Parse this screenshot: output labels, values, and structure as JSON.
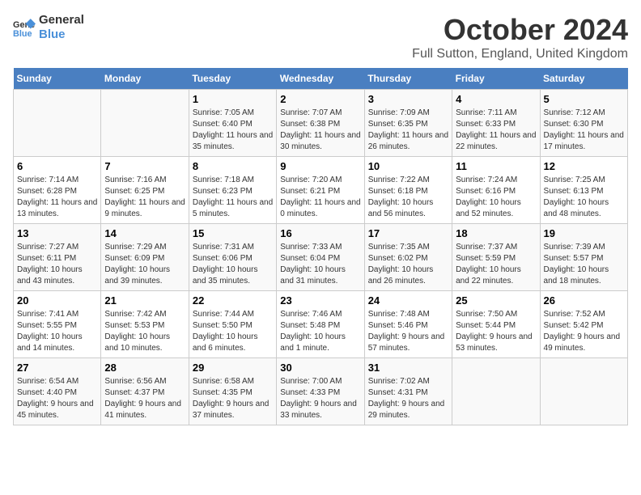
{
  "logo": {
    "line1": "General",
    "line2": "Blue"
  },
  "title": "October 2024",
  "subtitle": "Full Sutton, England, United Kingdom",
  "days_of_week": [
    "Sunday",
    "Monday",
    "Tuesday",
    "Wednesday",
    "Thursday",
    "Friday",
    "Saturday"
  ],
  "weeks": [
    [
      {
        "day": "",
        "sunrise": "",
        "sunset": "",
        "daylight": ""
      },
      {
        "day": "",
        "sunrise": "",
        "sunset": "",
        "daylight": ""
      },
      {
        "day": "1",
        "sunrise": "Sunrise: 7:05 AM",
        "sunset": "Sunset: 6:40 PM",
        "daylight": "Daylight: 11 hours and 35 minutes."
      },
      {
        "day": "2",
        "sunrise": "Sunrise: 7:07 AM",
        "sunset": "Sunset: 6:38 PM",
        "daylight": "Daylight: 11 hours and 30 minutes."
      },
      {
        "day": "3",
        "sunrise": "Sunrise: 7:09 AM",
        "sunset": "Sunset: 6:35 PM",
        "daylight": "Daylight: 11 hours and 26 minutes."
      },
      {
        "day": "4",
        "sunrise": "Sunrise: 7:11 AM",
        "sunset": "Sunset: 6:33 PM",
        "daylight": "Daylight: 11 hours and 22 minutes."
      },
      {
        "day": "5",
        "sunrise": "Sunrise: 7:12 AM",
        "sunset": "Sunset: 6:30 PM",
        "daylight": "Daylight: 11 hours and 17 minutes."
      }
    ],
    [
      {
        "day": "6",
        "sunrise": "Sunrise: 7:14 AM",
        "sunset": "Sunset: 6:28 PM",
        "daylight": "Daylight: 11 hours and 13 minutes."
      },
      {
        "day": "7",
        "sunrise": "Sunrise: 7:16 AM",
        "sunset": "Sunset: 6:25 PM",
        "daylight": "Daylight: 11 hours and 9 minutes."
      },
      {
        "day": "8",
        "sunrise": "Sunrise: 7:18 AM",
        "sunset": "Sunset: 6:23 PM",
        "daylight": "Daylight: 11 hours and 5 minutes."
      },
      {
        "day": "9",
        "sunrise": "Sunrise: 7:20 AM",
        "sunset": "Sunset: 6:21 PM",
        "daylight": "Daylight: 11 hours and 0 minutes."
      },
      {
        "day": "10",
        "sunrise": "Sunrise: 7:22 AM",
        "sunset": "Sunset: 6:18 PM",
        "daylight": "Daylight: 10 hours and 56 minutes."
      },
      {
        "day": "11",
        "sunrise": "Sunrise: 7:24 AM",
        "sunset": "Sunset: 6:16 PM",
        "daylight": "Daylight: 10 hours and 52 minutes."
      },
      {
        "day": "12",
        "sunrise": "Sunrise: 7:25 AM",
        "sunset": "Sunset: 6:13 PM",
        "daylight": "Daylight: 10 hours and 48 minutes."
      }
    ],
    [
      {
        "day": "13",
        "sunrise": "Sunrise: 7:27 AM",
        "sunset": "Sunset: 6:11 PM",
        "daylight": "Daylight: 10 hours and 43 minutes."
      },
      {
        "day": "14",
        "sunrise": "Sunrise: 7:29 AM",
        "sunset": "Sunset: 6:09 PM",
        "daylight": "Daylight: 10 hours and 39 minutes."
      },
      {
        "day": "15",
        "sunrise": "Sunrise: 7:31 AM",
        "sunset": "Sunset: 6:06 PM",
        "daylight": "Daylight: 10 hours and 35 minutes."
      },
      {
        "day": "16",
        "sunrise": "Sunrise: 7:33 AM",
        "sunset": "Sunset: 6:04 PM",
        "daylight": "Daylight: 10 hours and 31 minutes."
      },
      {
        "day": "17",
        "sunrise": "Sunrise: 7:35 AM",
        "sunset": "Sunset: 6:02 PM",
        "daylight": "Daylight: 10 hours and 26 minutes."
      },
      {
        "day": "18",
        "sunrise": "Sunrise: 7:37 AM",
        "sunset": "Sunset: 5:59 PM",
        "daylight": "Daylight: 10 hours and 22 minutes."
      },
      {
        "day": "19",
        "sunrise": "Sunrise: 7:39 AM",
        "sunset": "Sunset: 5:57 PM",
        "daylight": "Daylight: 10 hours and 18 minutes."
      }
    ],
    [
      {
        "day": "20",
        "sunrise": "Sunrise: 7:41 AM",
        "sunset": "Sunset: 5:55 PM",
        "daylight": "Daylight: 10 hours and 14 minutes."
      },
      {
        "day": "21",
        "sunrise": "Sunrise: 7:42 AM",
        "sunset": "Sunset: 5:53 PM",
        "daylight": "Daylight: 10 hours and 10 minutes."
      },
      {
        "day": "22",
        "sunrise": "Sunrise: 7:44 AM",
        "sunset": "Sunset: 5:50 PM",
        "daylight": "Daylight: 10 hours and 6 minutes."
      },
      {
        "day": "23",
        "sunrise": "Sunrise: 7:46 AM",
        "sunset": "Sunset: 5:48 PM",
        "daylight": "Daylight: 10 hours and 1 minute."
      },
      {
        "day": "24",
        "sunrise": "Sunrise: 7:48 AM",
        "sunset": "Sunset: 5:46 PM",
        "daylight": "Daylight: 9 hours and 57 minutes."
      },
      {
        "day": "25",
        "sunrise": "Sunrise: 7:50 AM",
        "sunset": "Sunset: 5:44 PM",
        "daylight": "Daylight: 9 hours and 53 minutes."
      },
      {
        "day": "26",
        "sunrise": "Sunrise: 7:52 AM",
        "sunset": "Sunset: 5:42 PM",
        "daylight": "Daylight: 9 hours and 49 minutes."
      }
    ],
    [
      {
        "day": "27",
        "sunrise": "Sunrise: 6:54 AM",
        "sunset": "Sunset: 4:40 PM",
        "daylight": "Daylight: 9 hours and 45 minutes."
      },
      {
        "day": "28",
        "sunrise": "Sunrise: 6:56 AM",
        "sunset": "Sunset: 4:37 PM",
        "daylight": "Daylight: 9 hours and 41 minutes."
      },
      {
        "day": "29",
        "sunrise": "Sunrise: 6:58 AM",
        "sunset": "Sunset: 4:35 PM",
        "daylight": "Daylight: 9 hours and 37 minutes."
      },
      {
        "day": "30",
        "sunrise": "Sunrise: 7:00 AM",
        "sunset": "Sunset: 4:33 PM",
        "daylight": "Daylight: 9 hours and 33 minutes."
      },
      {
        "day": "31",
        "sunrise": "Sunrise: 7:02 AM",
        "sunset": "Sunset: 4:31 PM",
        "daylight": "Daylight: 9 hours and 29 minutes."
      },
      {
        "day": "",
        "sunrise": "",
        "sunset": "",
        "daylight": ""
      },
      {
        "day": "",
        "sunrise": "",
        "sunset": "",
        "daylight": ""
      }
    ]
  ]
}
